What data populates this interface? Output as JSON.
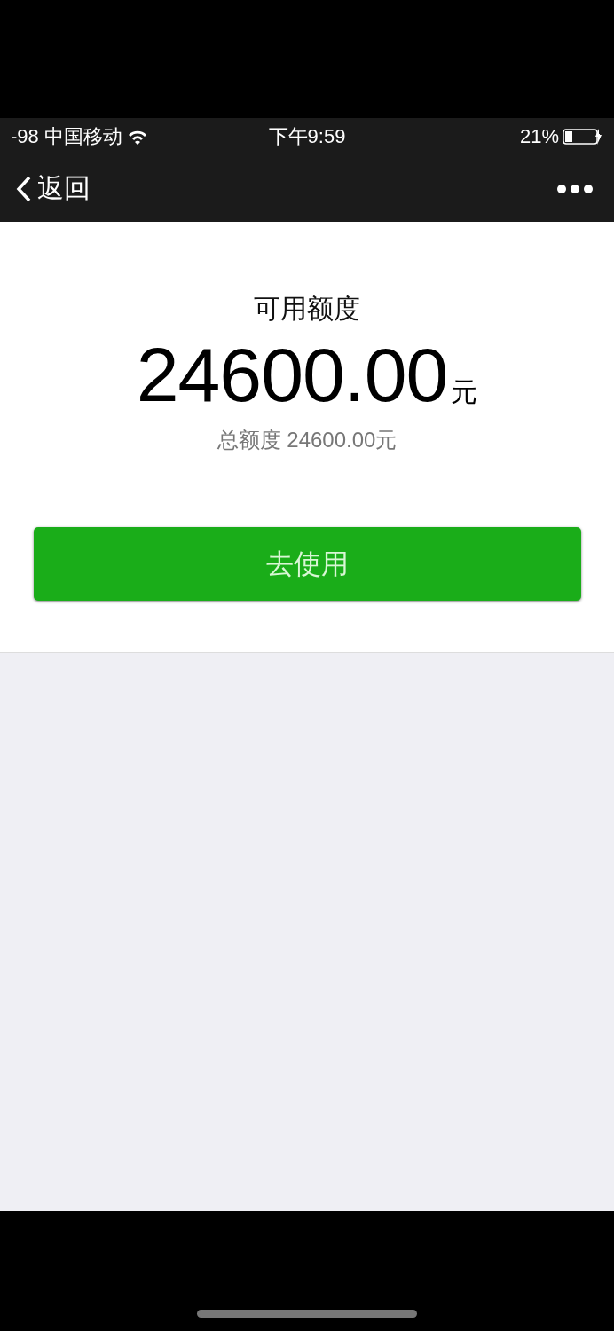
{
  "status_bar": {
    "signal": "-98",
    "carrier": "中国移动",
    "time": "下午9:59",
    "battery": "21%"
  },
  "nav_bar": {
    "back": "返回"
  },
  "credit": {
    "label": "可用额度",
    "amount": "24600.00",
    "unit": "元",
    "total": "总额度 24600.00元"
  },
  "button": {
    "label": "去使用"
  }
}
